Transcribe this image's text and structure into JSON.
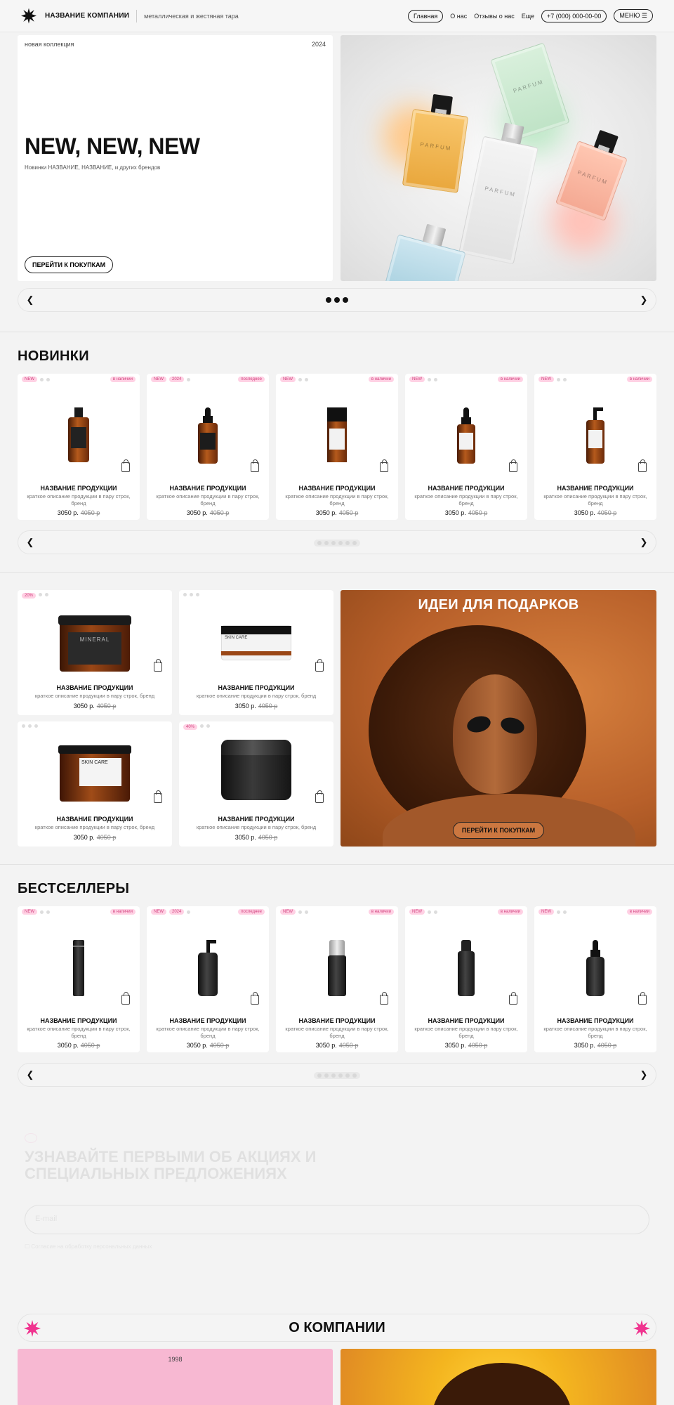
{
  "header": {
    "company": "НАЗВАНИЕ КОМПАНИИ",
    "tagline": "металлическая и жестяная тара",
    "nav": [
      "Главная",
      "О нас",
      "Отзывы о нас",
      "Еще"
    ],
    "phone": "+7 (000) 000-00-00",
    "menu": "МЕНЮ ☰"
  },
  "hero": {
    "kicker": "новая коллекция",
    "year": "2024",
    "title": "NEW, NEW, NEW",
    "subtitle": "Новинки НАЗВАНИЕ, НАЗВАНИЕ, и других брендов",
    "cta": "ПЕРЕЙТИ К ПОКУПКАМ",
    "bottle_label": "PARFUM"
  },
  "slider": {
    "prev": "❮",
    "next": "❯"
  },
  "new": {
    "title": "НОВИНКИ",
    "products": [
      {
        "badge": "NEW",
        "badge2": "",
        "stock": "в наличии",
        "name": "НАЗВАНИЕ ПРОДУКЦИИ",
        "desc": "краткое описание продукции в пару строк, бренд",
        "price": "3050 р.",
        "old": "4050 р"
      },
      {
        "badge": "NEW",
        "badge2": "2024",
        "stock": "последнее",
        "name": "НАЗВАНИЕ ПРОДУКЦИИ",
        "desc": "краткое описание продукции в пару строк, бренд",
        "price": "3050 р.",
        "old": "4050 р"
      },
      {
        "badge": "NEW",
        "badge2": "",
        "stock": "в наличии",
        "name": "НАЗВАНИЕ ПРОДУКЦИИ",
        "desc": "краткое описание продукции в пару строк, бренд",
        "price": "3050 р.",
        "old": "4050 р"
      },
      {
        "badge": "NEW",
        "badge2": "",
        "stock": "в наличии",
        "name": "НАЗВАНИЕ ПРОДУКЦИИ",
        "desc": "краткое описание продукции в пару строк, бренд",
        "price": "3050 р.",
        "old": "4050 р"
      },
      {
        "badge": "NEW",
        "badge2": "",
        "stock": "в наличии",
        "name": "НАЗВАНИЕ ПРОДУКЦИИ",
        "desc": "краткое описание продукции в пару строк, бренд",
        "price": "3050 р.",
        "old": "4050 р"
      }
    ]
  },
  "gifts": {
    "title": "ИДЕИ ДЛЯ ПОДАРКОВ",
    "cta": "ПЕРЕЙТИ К ПОКУПКАМ",
    "jar_label_1": "MINERAL",
    "jar_label_2": "SKIN CARE",
    "products": [
      {
        "badge": "20%",
        "name": "НАЗВАНИЕ ПРОДУКЦИИ",
        "desc": "краткое описание продукции в пару строк, бренд",
        "price": "3050 р.",
        "old": "4050 р"
      },
      {
        "badge": "",
        "name": "НАЗВАНИЕ ПРОДУКЦИИ",
        "desc": "краткое описание продукции в пару строк, бренд",
        "price": "3050 р.",
        "old": "4050 р"
      },
      {
        "badge": "",
        "name": "НАЗВАНИЕ ПРОДУКЦИИ",
        "desc": "краткое описание продукции в пару строк, бренд",
        "price": "3050 р.",
        "old": "4050 р"
      },
      {
        "badge": "40%",
        "name": "НАЗВАНИЕ ПРОДУКЦИИ",
        "desc": "краткое описание продукции в пару строк, бренд",
        "price": "3050 р.",
        "old": "4050 р"
      }
    ]
  },
  "best": {
    "title": "БЕСТСЕЛЛЕРЫ",
    "products": [
      {
        "badge": "NEW",
        "badge2": "",
        "stock": "в наличии",
        "name": "НАЗВАНИЕ ПРОДУКЦИИ",
        "desc": "краткое описание продукции в пару строк, бренд",
        "price": "3050 р.",
        "old": "4050 р"
      },
      {
        "badge": "NEW",
        "badge2": "2024",
        "stock": "последнее",
        "name": "НАЗВАНИЕ ПРОДУКЦИИ",
        "desc": "краткое описание продукции в пару строк, бренд",
        "price": "3050 р.",
        "old": "4050 р"
      },
      {
        "badge": "NEW",
        "badge2": "",
        "stock": "в наличии",
        "name": "НАЗВАНИЕ ПРОДУКЦИИ",
        "desc": "краткое описание продукции в пару строк, бренд",
        "price": "3050 р.",
        "old": "4050 р"
      },
      {
        "badge": "NEW",
        "badge2": "",
        "stock": "в наличии",
        "name": "НАЗВАНИЕ ПРОДУКЦИИ",
        "desc": "краткое описание продукции в пару строк, бренд",
        "price": "3050 р.",
        "old": "4050 р"
      },
      {
        "badge": "NEW",
        "badge2": "",
        "stock": "в наличии",
        "name": "НАЗВАНИЕ ПРОДУКЦИИ",
        "desc": "краткое описание продукции в пару строк, бренд",
        "price": "3050 р.",
        "old": "4050 р"
      }
    ]
  },
  "subscribe": {
    "title": "УЗНАВАЙТЕ ПЕРВЫМИ ОБ АКЦИЯХ И СПЕЦИАЛЬНЫХ ПРЕДЛОЖЕНИЯХ",
    "placeholder": "E-mail",
    "consent": "Согласие на обработку персональных данных"
  },
  "about": {
    "title": "О КОМПАНИИ",
    "year": "1998"
  },
  "colors": {
    "accent": "#f0338f",
    "badge_bg": "#ffd1e4",
    "badge_text": "#d2437f",
    "gift_bg": "#b8602a"
  }
}
